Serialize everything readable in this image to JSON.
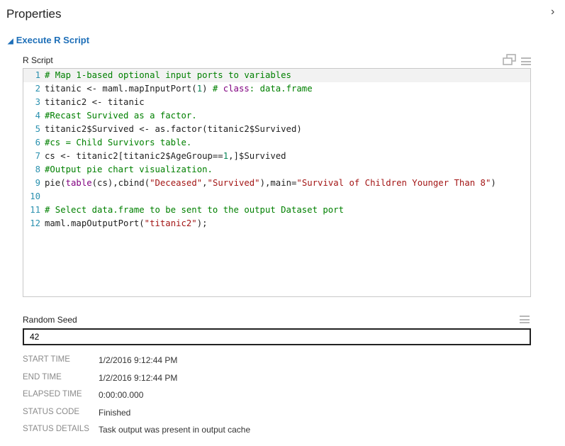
{
  "panel": {
    "title": "Properties",
    "collapse_glyph": "›"
  },
  "section": {
    "title": "Execute R Script",
    "expand_glyph": "◢"
  },
  "rscript": {
    "label": "R Script",
    "icons": [
      "popout-icon",
      "menu-icon"
    ],
    "lines": [
      [
        {
          "t": "# Map 1-based optional input ports to variables",
          "c": "comment"
        }
      ],
      [
        {
          "t": "titanic <- maml.mapInputPort(",
          "c": ""
        },
        {
          "t": "1",
          "c": "number"
        },
        {
          "t": ") ",
          "c": ""
        },
        {
          "t": "# ",
          "c": "comment"
        },
        {
          "t": "class",
          "c": "keyword"
        },
        {
          "t": ": data.frame",
          "c": "comment"
        }
      ],
      [
        {
          "t": "titanic2 <- titanic",
          "c": ""
        }
      ],
      [
        {
          "t": "#Recast Survived as a factor.",
          "c": "comment"
        }
      ],
      [
        {
          "t": "titanic2$Survived <- as.factor(titanic2$Survived)",
          "c": ""
        }
      ],
      [
        {
          "t": "#cs = Child Survivors table.",
          "c": "comment"
        }
      ],
      [
        {
          "t": "cs <- titanic2[titanic2$AgeGroup==",
          "c": ""
        },
        {
          "t": "1",
          "c": "number"
        },
        {
          "t": ",]$Survived",
          "c": ""
        }
      ],
      [
        {
          "t": "#Output pie chart visualization.",
          "c": "comment"
        }
      ],
      [
        {
          "t": "pie(",
          "c": ""
        },
        {
          "t": "table",
          "c": "fn"
        },
        {
          "t": "(cs),cbind(",
          "c": ""
        },
        {
          "t": "\"Deceased\"",
          "c": "string"
        },
        {
          "t": ",",
          "c": ""
        },
        {
          "t": "\"Survived\"",
          "c": "string"
        },
        {
          "t": "),main=",
          "c": ""
        },
        {
          "t": "\"Survival of Children Younger Than 8\"",
          "c": "string"
        },
        {
          "t": ")",
          "c": ""
        }
      ],
      [
        {
          "t": "",
          "c": ""
        }
      ],
      [
        {
          "t": "# Select data.frame to be sent to the output Dataset port",
          "c": "comment"
        }
      ],
      [
        {
          "t": "maml.mapOutputPort(",
          "c": ""
        },
        {
          "t": "\"titanic2\"",
          "c": "string"
        },
        {
          "t": ");",
          "c": ""
        }
      ]
    ]
  },
  "random_seed": {
    "label": "Random Seed",
    "value": "42"
  },
  "meta": [
    {
      "key": "START TIME",
      "value": "1/2/2016 9:12:44 PM"
    },
    {
      "key": "END TIME",
      "value": "1/2/2016 9:12:44 PM"
    },
    {
      "key": "ELAPSED TIME",
      "value": "0:00:00.000"
    },
    {
      "key": "STATUS CODE",
      "value": "Finished"
    },
    {
      "key": "STATUS DETAILS",
      "value": "Task output was present in output cache"
    }
  ]
}
